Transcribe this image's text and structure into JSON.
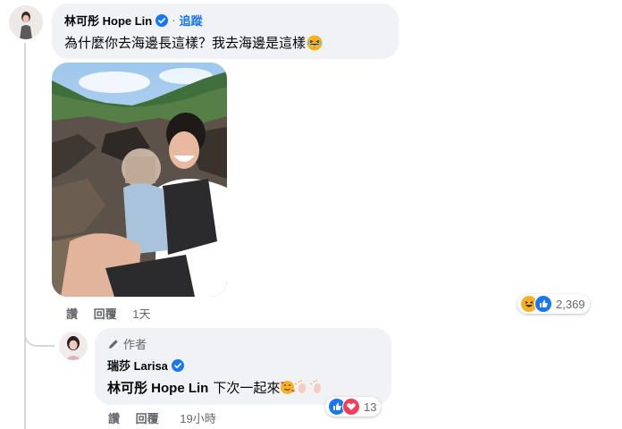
{
  "comment": {
    "author": "林可彤 Hope Lin",
    "follow_label": "追蹤",
    "text": "為什麼你去海邊長這樣？我去海邊是這樣",
    "actions": {
      "like": "讚",
      "reply": "回覆",
      "time": "1天"
    },
    "reactions": {
      "types": [
        "haha-icon",
        "like-icon"
      ],
      "count": "2,369"
    }
  },
  "reply": {
    "badge": "作者",
    "author": "瑞莎 Larisa",
    "mention": "林可彤 Hope Lin",
    "text": "下次一起來",
    "actions": {
      "like": "讚",
      "reply": "回覆",
      "time": "19小時"
    },
    "reactions": {
      "types": [
        "like-icon",
        "love-icon"
      ],
      "count": "13"
    }
  },
  "colors": {
    "accent": "#1877f2",
    "bubble": "#f0f2f5",
    "meta": "#65676b",
    "love": "#f33e58",
    "haha": "#f7b125"
  }
}
